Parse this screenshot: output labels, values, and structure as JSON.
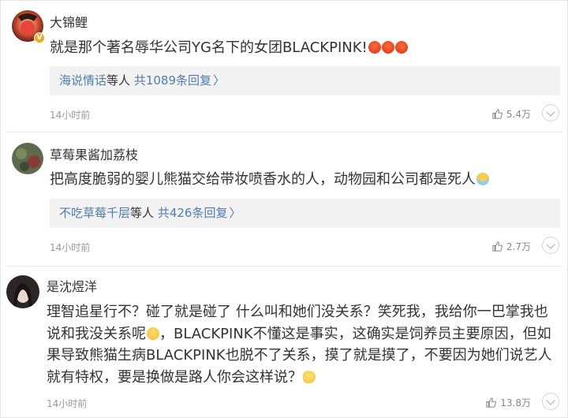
{
  "comments": [
    {
      "username": "大锦鲤",
      "verified_badge": "V",
      "content": "就是那个著名辱华公司YG名下的女团BLACKPINK!",
      "emojis": [
        "angry-face-emoji",
        "angry-face-emoji",
        "angry-face-emoji"
      ],
      "replies": {
        "names": "海说情话",
        "mid": "等人",
        "count": "共1089条回复",
        "chevron": "〉"
      },
      "time": "14小时前",
      "likes": "5.4万"
    },
    {
      "username": "草莓果酱加荔枝",
      "content": "把高度脆弱的婴儿熊猫交给带妆喷香水的人，动物园和公司都是死人",
      "emojis": [
        "cold-face-emoji"
      ],
      "replies": {
        "names": "不吃草莓千层",
        "mid": "等人",
        "count": "共426条回复",
        "chevron": "〉"
      },
      "time": "14小时前",
      "likes": "2.7万"
    },
    {
      "username": "是沈煜洋",
      "content_a": "理智追星行不？碰了就是碰了 什么叫和她们没关系？笑死我，我给你一巴掌我也说和我没关系呢",
      "content_b": "，BLACKPINK不懂这是事实，这确实是饲养员主要原因，但如果导致熊猫生病BLACKPINK也脱不了关系，摸了就是摸了，不要因为她们说艺人就有特权，要是换做是路人你会这样说？",
      "emojis": [
        "cry-face-emoji",
        "thinking-face-emoji"
      ],
      "time": "14小时前",
      "likes": "13.8万"
    }
  ],
  "colors": {
    "link": "#507daf",
    "text": "#333333",
    "muted": "#999999",
    "reply_bg": "#f2f2f2",
    "badge": "#f5a623"
  }
}
